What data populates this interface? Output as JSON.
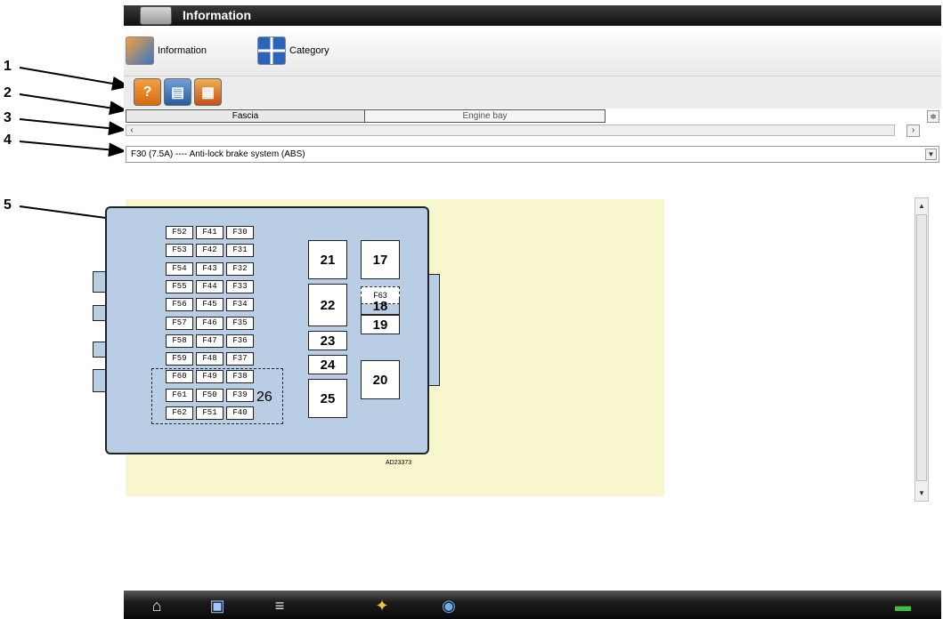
{
  "callouts": [
    "1",
    "2",
    "3",
    "4",
    "5"
  ],
  "window": {
    "title": "Information",
    "nav": {
      "information_label": "Information",
      "category_label": "Category"
    },
    "toolbar": {
      "help_icon": "help-icon",
      "print_icon": "print-icon",
      "vehicle_icon": "vehicle-data-icon"
    },
    "tabs": [
      {
        "label": "Fascia",
        "active": true
      },
      {
        "label": "Engine bay",
        "active": false
      }
    ],
    "fuse_select": {
      "selected": "F30 (7.5A) ---- Anti-lock brake system (ABS)"
    },
    "diagram": {
      "code": "AD23373",
      "fuse_rows": [
        [
          "F52",
          "F41",
          "F30"
        ],
        [
          "F53",
          "F42",
          "F31"
        ],
        [
          "F54",
          "F43",
          "F32"
        ],
        [
          "F55",
          "F44",
          "F33"
        ],
        [
          "F56",
          "F45",
          "F34"
        ],
        [
          "F57",
          "F46",
          "F35"
        ],
        [
          "F58",
          "F47",
          "F36"
        ],
        [
          "F59",
          "F48",
          "F37"
        ],
        [
          "F60",
          "F49",
          "F38"
        ],
        [
          "F61",
          "F50",
          "F39"
        ],
        [
          "F62",
          "F51",
          "F40"
        ]
      ],
      "relays": [
        "21",
        "22",
        "23",
        "24",
        "25",
        "17",
        "18",
        "19",
        "20"
      ],
      "f63": "F63",
      "group_label": "26",
      "colors": {
        "background": "#f7f6cc",
        "box": "#b9cde4"
      }
    },
    "taskbar": {
      "items": [
        "home-icon",
        "display-icon",
        "tools-icon",
        "vehicle-icon",
        "data-icon",
        "connection-icon"
      ]
    }
  }
}
